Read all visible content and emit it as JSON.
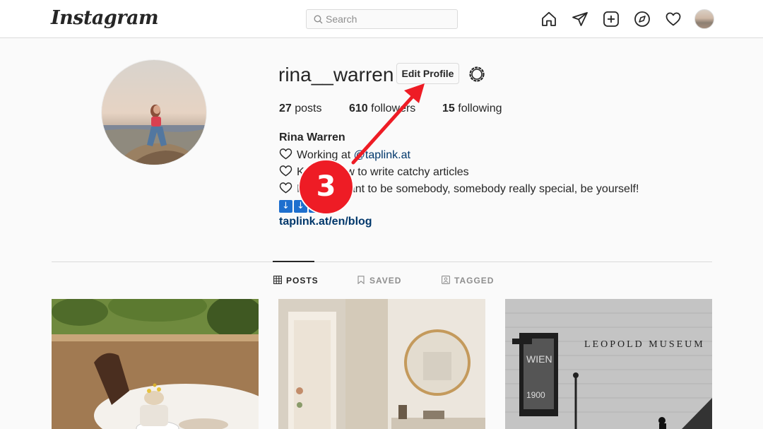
{
  "header": {
    "logo": "Instagram",
    "search_placeholder": "Search"
  },
  "profile": {
    "username": "rina__warren",
    "edit_profile_label": "Edit Profile",
    "stats": {
      "posts_count": "27",
      "posts_label": "posts",
      "followers_count": "610",
      "followers_label": "followers",
      "following_count": "15",
      "following_label": "following"
    },
    "full_name": "Rina Warren",
    "bio": {
      "line1_text": "Working at ",
      "line1_link": "@taplink.at",
      "line2_text": "Knows how to write catchy articles",
      "line3_text": "It is important to be somebody, somebody really special, be yourself!",
      "emoji_glyph": "↓"
    },
    "website": "taplink.at/en/blog"
  },
  "tabs": [
    {
      "label": "POSTS",
      "icon": "grid-icon",
      "active": true
    },
    {
      "label": "SAVED",
      "icon": "bookmark-icon",
      "active": false
    },
    {
      "label": "TAGGED",
      "icon": "tagged-icon",
      "active": false
    }
  ],
  "posts": {
    "post3_caption": "LEOPOLD MUSEUM",
    "post3_sign": "WIEN",
    "post3_sign_year": "1900"
  },
  "annotation": {
    "step_number": "3",
    "color": "#ee1c25"
  },
  "colors": {
    "link": "#00376b",
    "border": "#dbdbdb",
    "background": "#fafafa"
  }
}
